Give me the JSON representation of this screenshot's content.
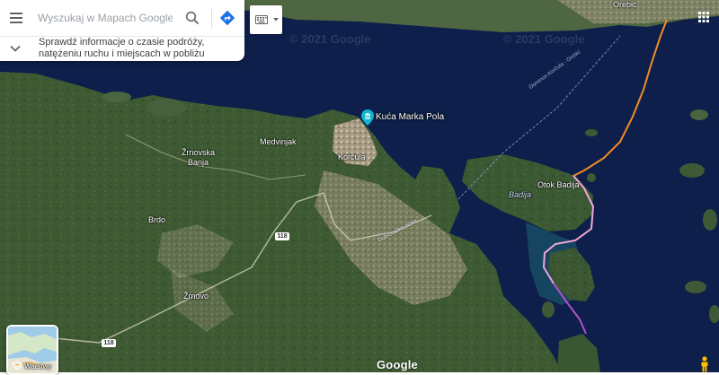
{
  "search": {
    "placeholder": "Wyszukaj w Mapach Google",
    "menu_icon": "menu-icon",
    "search_icon": "search-icon",
    "directions_icon": "directions-icon"
  },
  "info": {
    "text": "Sprawdź informacje o czasie podróży, natężeniu ruchu i miejscach w pobliżu",
    "icon": "chevron-down-icon"
  },
  "keyboard": {
    "icon": "keyboard-icon",
    "dropdown_icon": "caret-down-icon"
  },
  "apps": {
    "icon": "apps-grid-icon"
  },
  "layers": {
    "label": "Warstwy",
    "icon": "layers-icon"
  },
  "pegman": {
    "icon": "pegman-icon"
  },
  "logo": {
    "text": "Google"
  },
  "copyright": {
    "text": "© 2021 Google"
  },
  "places": [
    {
      "id": "orebic",
      "text": "Orebić"
    },
    {
      "id": "zrnovska_banja",
      "text": "Žrnovska\nBanja"
    },
    {
      "id": "medvinjak",
      "text": "Medvinjak"
    },
    {
      "id": "korcula",
      "text": "Korčula"
    },
    {
      "id": "brdo",
      "text": "Brdo"
    },
    {
      "id": "zrnovo",
      "text": "Žrnovo"
    },
    {
      "id": "otok_badija",
      "text": "Otok Badija"
    },
    {
      "id": "badija",
      "text": "Badija"
    }
  ],
  "poi": {
    "text": "Kuća Marka Pola",
    "icon": "museum-pin-icon"
  },
  "roads": [
    {
      "id": "road_118_a",
      "text": "118"
    },
    {
      "id": "road_118_b",
      "text": "118"
    }
  ],
  "road_label": {
    "text": "Dubrovačka cesta"
  },
  "ferry_label": {
    "text": "Domince-Korčula - Orebić"
  },
  "colors": {
    "sea": "#0d1f4a",
    "land": "#3e5a33",
    "route_orange": "#f28c28",
    "route_pink": "#f4a6d8",
    "route_purple": "#b052c7",
    "directions_blue": "#1a73e8"
  }
}
